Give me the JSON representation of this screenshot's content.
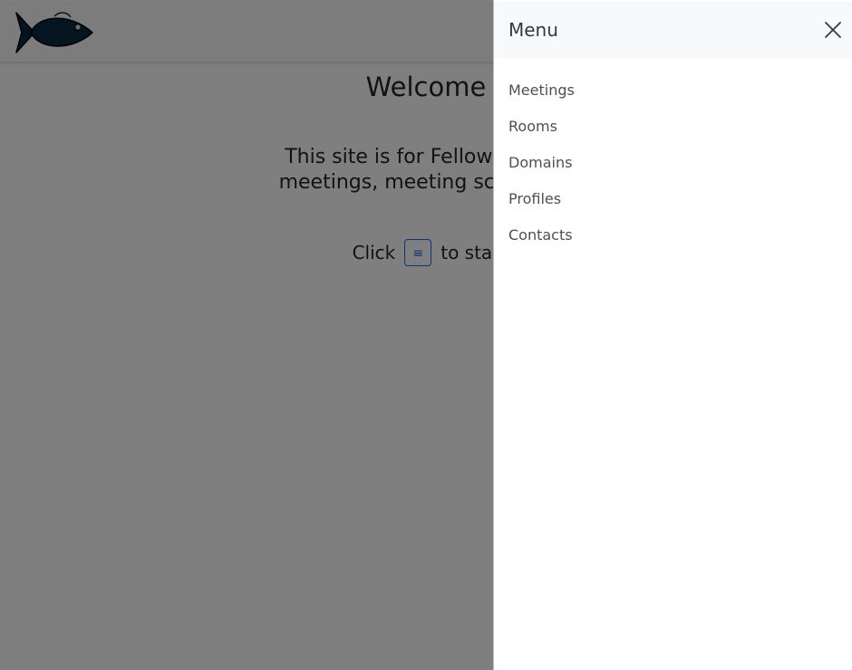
{
  "header": {
    "logo_icon": "fish-logo-icon"
  },
  "main": {
    "welcome_title": "Welcome",
    "intro_line1": "This site is for Fellow Jitsters",
    "intro_line2": "meetings, meeting schedules",
    "click_prefix": "Click",
    "menu_button_glyph": "≡",
    "click_suffix": "to star"
  },
  "offcanvas": {
    "title": "Menu",
    "close_icon": "close-icon",
    "items": [
      {
        "label": "Meetings"
      },
      {
        "label": "Rooms"
      },
      {
        "label": "Domains"
      },
      {
        "label": "Profiles"
      },
      {
        "label": "Contacts"
      }
    ]
  },
  "colors": {
    "navbar_bg": "#f8f9fa",
    "backdrop": "rgba(0,0,0,0.5)",
    "fish_body": "#0b2a3f",
    "accent": "#0d6efd"
  }
}
